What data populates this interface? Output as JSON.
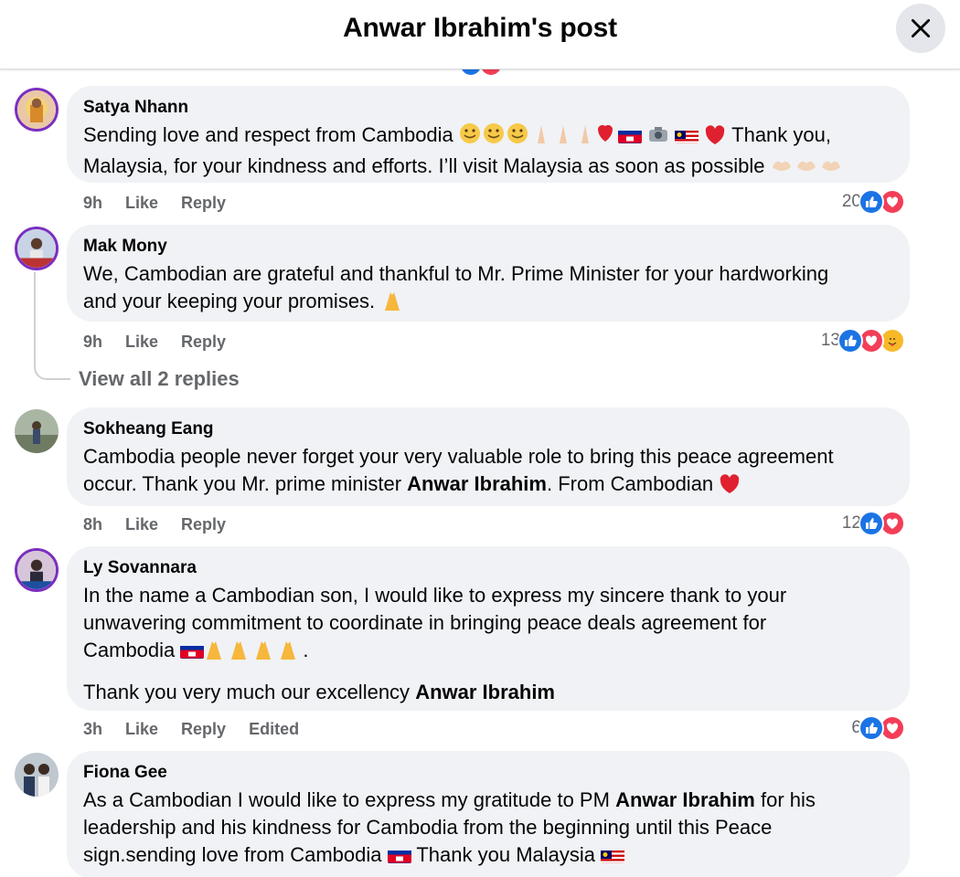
{
  "header": {
    "title": "Anwar Ibrahim's post"
  },
  "comments": [
    {
      "author": "Satya Nhann",
      "line1a": "Sending love and respect from Cambodia",
      "line1b": "Thank you,",
      "line2": "Malaysia, for your kindness and efforts. I’ll visit Malaysia as soon as possible",
      "time": "9h",
      "like": "Like",
      "reply": "Reply",
      "count": "20"
    },
    {
      "author": "Mak Mony",
      "line1": "We, Cambodian are grateful and thankful to Mr. Prime Minister for your hardworking",
      "line2": "and your keeping your promises.",
      "time": "9h",
      "like": "Like",
      "reply": "Reply",
      "count": "13"
    },
    {
      "author": "Sokheang Eang",
      "line1": "Cambodia people never forget your very valuable role to bring this peace agreement",
      "line2a": "occur. Thank you Mr. prime minister",
      "line2b": "Anwar Ibrahim",
      "line2c": ". From Cambodian",
      "time": "8h",
      "like": "Like",
      "reply": "Reply",
      "count": "12"
    },
    {
      "author": "Ly Sovannara",
      "line1": "In the name a Cambodian son, I would like to express my sincere thank to your",
      "line2": "unwavering commitment to coordinate in bringing peace deals agreement for",
      "line3": "Cambodia",
      "line3end": ".",
      "line4a": "Thank you very much our excellency",
      "line4b": "Anwar Ibrahim",
      "time": "3h",
      "like": "Like",
      "reply": "Reply",
      "edited": "Edited",
      "count": "6"
    },
    {
      "author": "Fiona Gee",
      "line1a": "As a Cambodian I would like to express my gratitude to PM",
      "line1b": "Anwar Ibrahim",
      "line1c": "for his",
      "line2": "leadership and his kindness for Cambodia from the beginning until this Peace",
      "line3a": "sign.sending love from Cambodia",
      "line3b": "Thank you Malaysia"
    }
  ],
  "view_replies": "View all 2 replies",
  "icons": {
    "close": "close-icon",
    "like": "like-reaction-icon",
    "love": "love-reaction-icon",
    "care": "care-reaction-icon"
  },
  "colors": {
    "like": "#1b74e4",
    "love": "#f33e58",
    "care": "#f7b928",
    "bubble": "#f0f2f5",
    "meta": "#65676b"
  }
}
